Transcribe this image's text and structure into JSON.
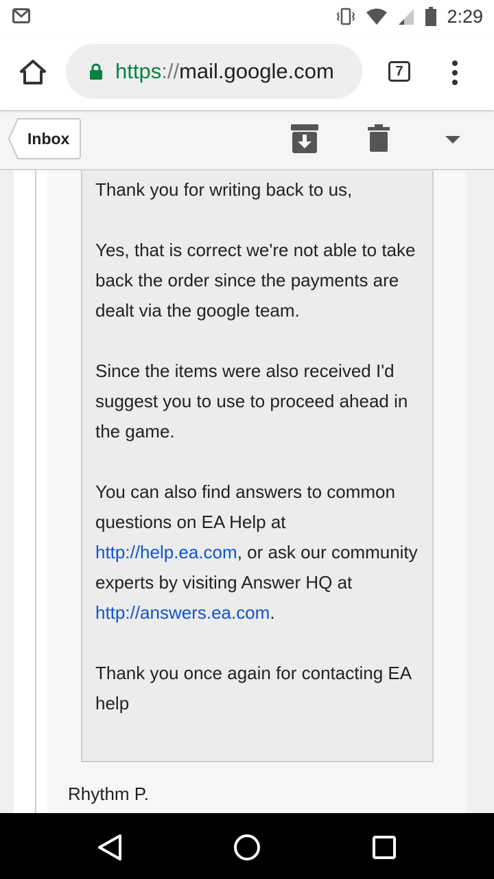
{
  "status_bar": {
    "time": "2:29"
  },
  "browser": {
    "url_scheme": "https",
    "url_separator": "://",
    "url_host": "mail.google.com",
    "tab_count": "7"
  },
  "gmail": {
    "back_label": "Inbox"
  },
  "email": {
    "p1": "Thank you for writing back to us,",
    "p2": "Yes, that is correct we're not able to take back the order since the payments are dealt via the google team.",
    "p3": "Since the items were also received I'd suggest you to use to proceed ahead in the game.",
    "p4_a": "You can also find answers to common questions on EA Help at ",
    "p4_link1": "http://help.ea.com",
    "p4_b": ", or ask our community experts by visiting Answer HQ at ",
    "p4_link2": "http://answers.ea.com",
    "p4_c": ".",
    "p5": "Thank you once again for contacting EA help",
    "signature": "Rhythm P."
  },
  "colors": {
    "link": "#1155cc",
    "secure": "#0b8043"
  }
}
